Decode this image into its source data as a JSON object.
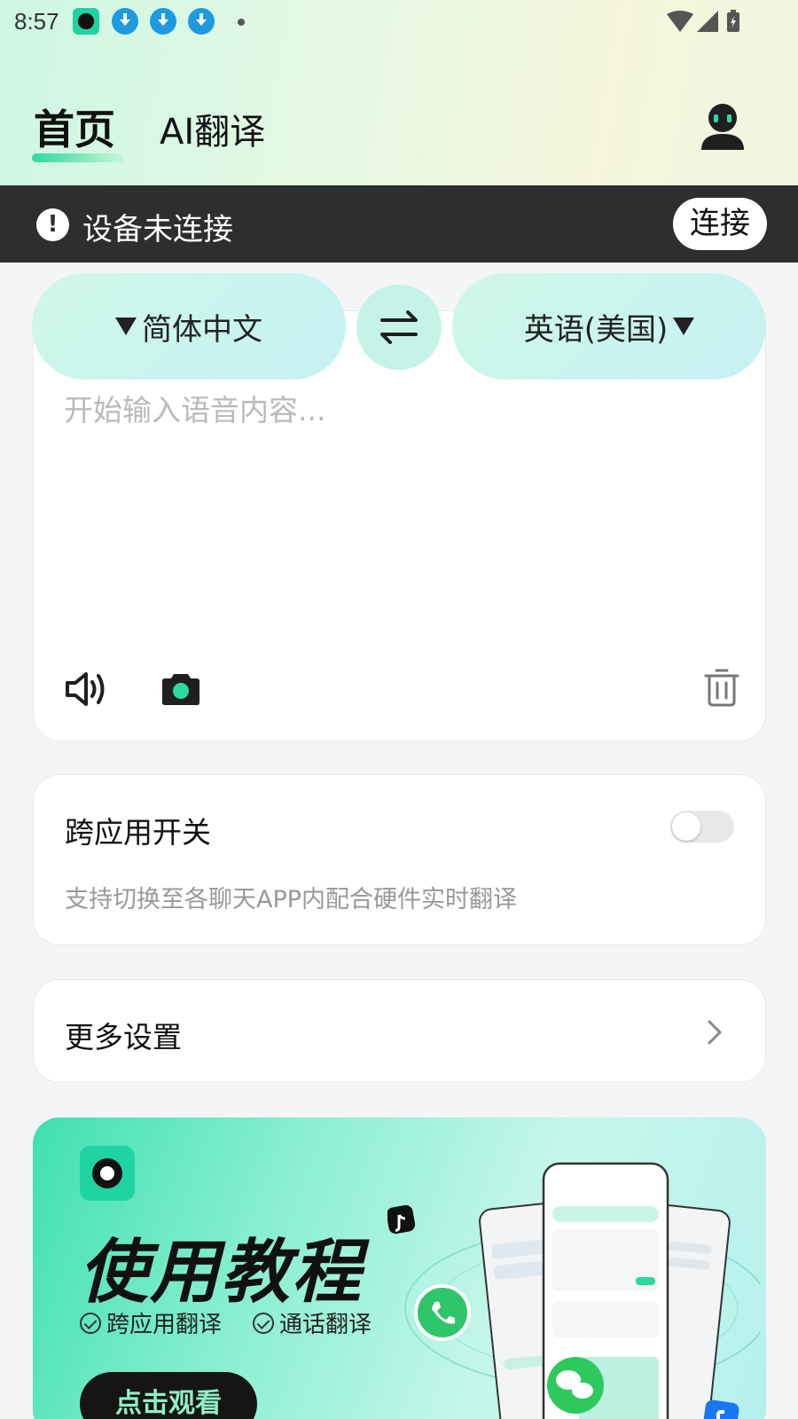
{
  "status_bar": {
    "time": "8:57"
  },
  "header": {
    "tabs": [
      {
        "label": "首页",
        "active": true
      },
      {
        "label": "AI翻译",
        "active": false
      }
    ]
  },
  "device_banner": {
    "text": "设备未连接",
    "connect_label": "连接",
    "alert_icon": "!"
  },
  "translator": {
    "source_language": "简体中文",
    "target_language": "英语(美国)",
    "input_placeholder": "开始输入语音内容...",
    "icons": [
      "speaker-icon",
      "camera-icon",
      "trash-icon",
      "swap-icon"
    ]
  },
  "cross_app": {
    "title": "跨应用开关",
    "description": "支持切换至各聊天APP内配合硬件实时翻译",
    "enabled": false
  },
  "more_settings": {
    "label": "更多设置"
  },
  "tutorial": {
    "title": "使用教程",
    "features": [
      "跨应用翻译",
      "通话翻译"
    ],
    "watch_label": "点击观看"
  },
  "colors": {
    "accent": "#2cd9a0",
    "banner_bg": "#2d2e2f",
    "pill_bg": "#cff8e8",
    "placeholder": "#b8babc"
  }
}
